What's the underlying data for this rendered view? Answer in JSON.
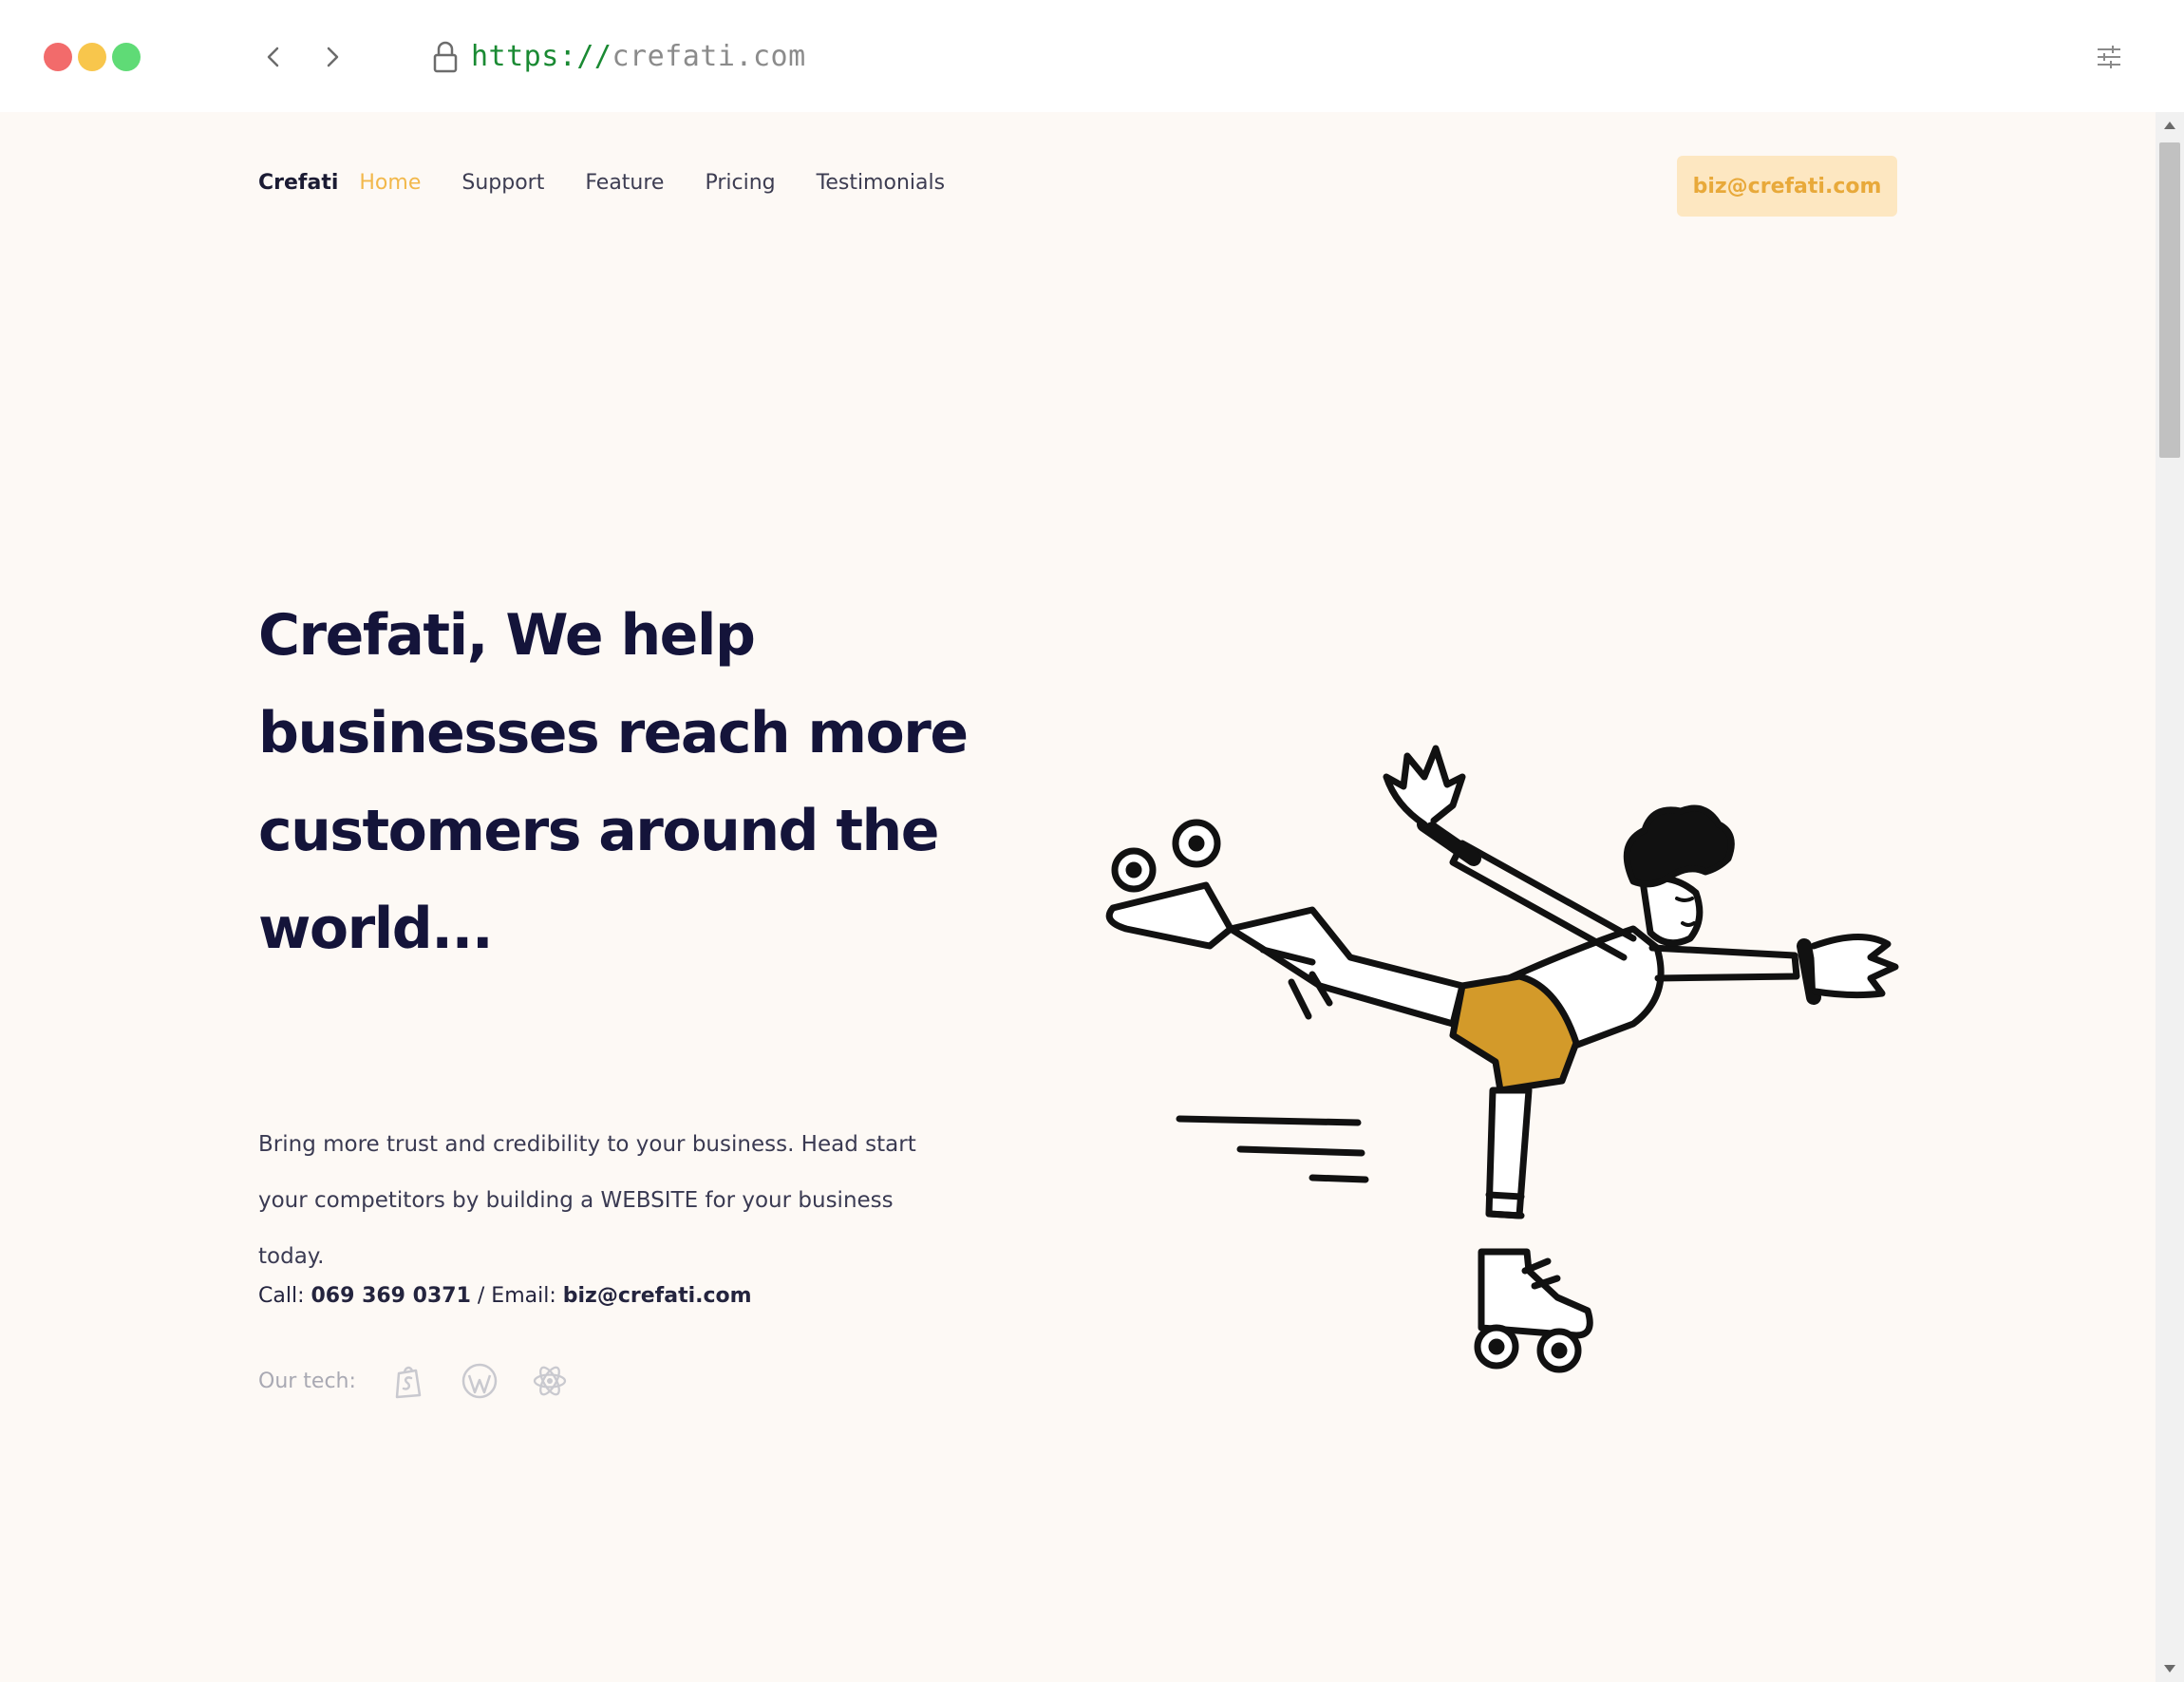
{
  "browser": {
    "url_scheme": "https://",
    "url_host": "crefati.com"
  },
  "nav": {
    "brand": "Crefati",
    "links": [
      "Home",
      "Support",
      "Feature",
      "Pricing",
      "Testimonials"
    ],
    "active_link": "Home",
    "cta_email": "biz@crefati.com"
  },
  "hero": {
    "title": "Crefati, We help businesses reach more customers around the world...",
    "description": "Bring more trust and credibility to your business. Head start your competitors by building a WEBSITE for your business today.",
    "call_label": "Call:",
    "phone": "069 369 0371",
    "separator": "/ Email:",
    "email": "biz@crefati.com",
    "tech_label": "Our tech:",
    "tech_icons": [
      "shopify-icon",
      "wordpress-icon",
      "react-icon"
    ]
  },
  "colors": {
    "accent": "#f2b84b",
    "cta_bg": "#fde7c1",
    "heading": "#14143a",
    "page_bg": "#fdf9f5",
    "shorts": "#d39a2a"
  }
}
